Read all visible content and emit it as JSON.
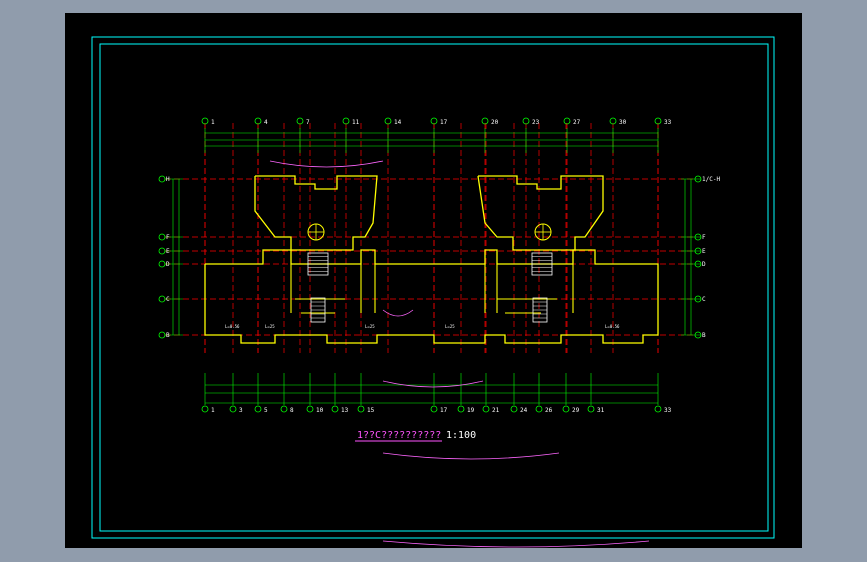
{
  "drawing": {
    "title": "1??C??????????",
    "scale": "1:100",
    "colors": {
      "background": "#000000",
      "border": "#00ffff",
      "axis_line": "#ff0000",
      "wall": "#ffff00",
      "dimension": "#00ff00",
      "stair": "#ffffff",
      "title": "#ff55ff"
    }
  },
  "top_axes": [
    "1",
    "4",
    "7",
    "11",
    "14",
    "17",
    "20",
    "23",
    "27",
    "30",
    "33"
  ],
  "bottom_axes": [
    "1",
    "3",
    "5",
    "8",
    "10",
    "13",
    "15",
    "17",
    "19",
    "21",
    "24",
    "26",
    "29",
    "31",
    "33"
  ],
  "left_axes": [
    "H",
    "F",
    "E",
    "D",
    "C",
    "B"
  ],
  "right_axes": [
    "1/C-H",
    "F",
    "E",
    "D",
    "C",
    "B"
  ],
  "rooms": [
    {
      "label": "L=0.56"
    },
    {
      "label": "L=25"
    },
    {
      "label": "L=25"
    },
    {
      "label": "L=25"
    },
    {
      "label": "L=0.56"
    }
  ]
}
